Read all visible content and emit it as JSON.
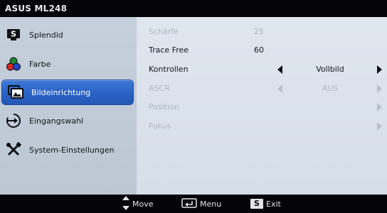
{
  "title": "ASUS ML248",
  "sidebar": {
    "items": [
      {
        "label": "Splendid",
        "icon": "s-badge-icon"
      },
      {
        "label": "Farbe",
        "icon": "color-circles-icon"
      },
      {
        "label": "Bildeinrichtung",
        "icon": "picture-icon",
        "active": true
      },
      {
        "label": "Eingangswahl",
        "icon": "input-source-icon"
      },
      {
        "label": "System-Einstellungen",
        "icon": "tools-icon"
      }
    ]
  },
  "settings": [
    {
      "label": "Schärfe",
      "value": "25",
      "enabled": false
    },
    {
      "label": "Trace Free",
      "value": "60",
      "enabled": true
    },
    {
      "label": "Kontrollen",
      "value": "Vollbild",
      "enabled": true
    },
    {
      "label": "ASCR",
      "value": "AUS",
      "enabled": false
    },
    {
      "label": "Position",
      "value": "",
      "enabled": false
    },
    {
      "label": "Fokus",
      "value": "",
      "enabled": false
    }
  ],
  "footer": {
    "move_label": "Move",
    "menu_label": "Menu",
    "exit_label": "Exit",
    "exit_key": "S"
  },
  "colors": {
    "accent": "#2a62c4",
    "panel": "#d6dee8",
    "sidebar": "#c2ccd8",
    "bar": "#050507"
  }
}
